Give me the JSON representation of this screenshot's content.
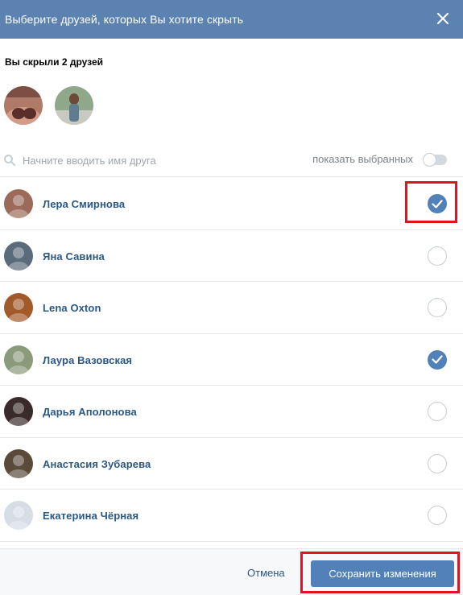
{
  "header": {
    "title": "Выберите друзей, которых Вы хотите скрыть",
    "close_icon": "close-icon"
  },
  "hidden_section": {
    "title": "Вы скрыли 2 друзей",
    "avatars": [
      "avatar-photo-1",
      "avatar-photo-2"
    ]
  },
  "search": {
    "placeholder": "Начните вводить имя друга",
    "value": "",
    "icon": "search-icon",
    "show_selected_label": "показать выбранных",
    "show_selected_on": false
  },
  "friends": [
    {
      "name": "Лера Смирнова",
      "checked": true,
      "avatar_color": "#9c6a5a"
    },
    {
      "name": "Яна Савина",
      "checked": false,
      "avatar_color": "#5a6b7a"
    },
    {
      "name": "Lena Oxton",
      "checked": false,
      "avatar_color": "#a25a2a"
    },
    {
      "name": "Лаура Вазовская",
      "checked": true,
      "avatar_color": "#8a9a7a"
    },
    {
      "name": "Дарья Аполонова",
      "checked": false,
      "avatar_color": "#3a2a2a"
    },
    {
      "name": "Анастасия Зубарева",
      "checked": false,
      "avatar_color": "#5a4a3a"
    },
    {
      "name": "Екатерина Чёрная",
      "checked": false,
      "avatar_color": "#d6dde5"
    }
  ],
  "footer": {
    "cancel_label": "Отмена",
    "save_label": "Сохранить изменения"
  },
  "colors": {
    "header_bg": "#5b82b0",
    "accent": "#5181b8",
    "link": "#2a5885",
    "highlight": "#e0141e"
  }
}
